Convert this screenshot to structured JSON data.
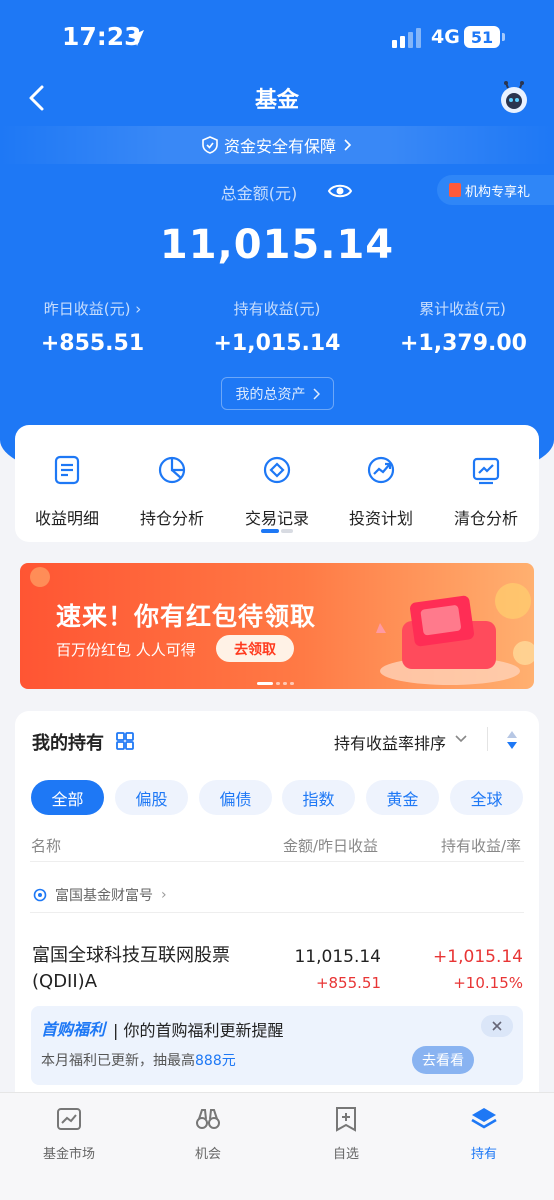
{
  "status_bar": {
    "time": "17:23",
    "network": "4G",
    "battery": "51"
  },
  "nav": {
    "title": "基金"
  },
  "safety_text": "资金安全有保障",
  "promo_tag": "机构专享礼",
  "summary": {
    "total_label": "总金额(元)",
    "total_amount": "11,015.14",
    "yesterday_label": "昨日收益(元)",
    "yesterday_value": "+855.51",
    "holding_label": "持有收益(元)",
    "holding_value": "+1,015.14",
    "cumulative_label": "累计收益(元)",
    "cumulative_value": "+1,379.00",
    "assets_button": "我的总资产"
  },
  "quick_menu": [
    {
      "label": "收益明细",
      "icon": "document-icon"
    },
    {
      "label": "持仓分析",
      "icon": "pie-chart-icon"
    },
    {
      "label": "交易记录",
      "icon": "record-icon"
    },
    {
      "label": "投资计划",
      "icon": "trend-icon"
    },
    {
      "label": "清仓分析",
      "icon": "chart-board-icon"
    }
  ],
  "banner": {
    "title": "速来！你有红包待领取",
    "subtitle": "百万份红包 人人可得",
    "button": "去领取"
  },
  "holdings": {
    "title": "我的持有",
    "sort_label": "持有收益率排序",
    "filters": [
      "全部",
      "偏股",
      "偏债",
      "指数",
      "黄金",
      "全球"
    ],
    "active_filter": "全部",
    "columns": {
      "name": "名称",
      "amount": "金额/昨日收益",
      "profit": "持有收益/率"
    },
    "company": "富国基金财富号",
    "fund": {
      "name": "富国全球科技互联网股票(QDII)A",
      "amount": "11,015.14",
      "yesterday": "+855.51",
      "profit": "+1,015.14",
      "rate": "+10.15%"
    },
    "welfare": {
      "brand": "首购福利",
      "message": "| 你的首购福利更新提醒",
      "sub_prefix": "本月福利已更新，抽最高",
      "sub_highlight": "888元",
      "button": "去看看"
    }
  },
  "tabbar": [
    {
      "label": "基金市场",
      "icon": "market-icon"
    },
    {
      "label": "机会",
      "icon": "binoculars-icon"
    },
    {
      "label": "自选",
      "icon": "add-favorite-icon"
    },
    {
      "label": "持有",
      "icon": "layers-icon"
    }
  ],
  "colors": {
    "primary": "#1e78f5",
    "up": "#e83535",
    "banner": "#ff5533"
  }
}
